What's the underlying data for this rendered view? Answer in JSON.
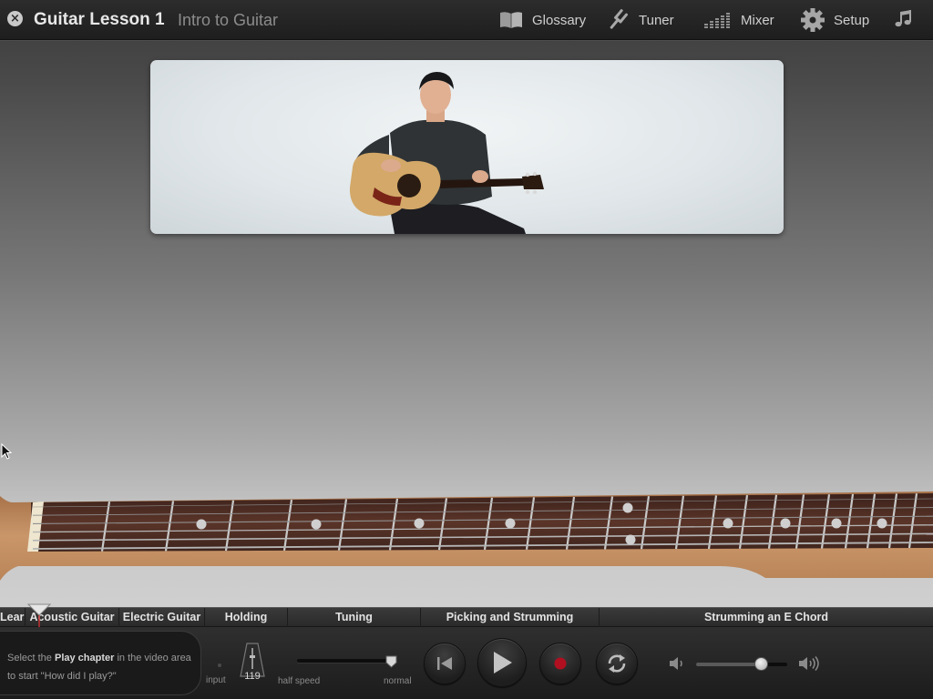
{
  "header": {
    "title": "Guitar Lesson 1",
    "subtitle": "Intro to Guitar",
    "nav": [
      {
        "label": "Glossary",
        "icon": "book-icon"
      },
      {
        "label": "Tuner",
        "icon": "tuning-fork-icon"
      },
      {
        "label": "Mixer",
        "icon": "mixer-icon"
      },
      {
        "label": "Setup",
        "icon": "gear-icon"
      },
      {
        "label": "",
        "icon": "music-note-icon"
      }
    ]
  },
  "chapters": [
    "Lear",
    "Acoustic Guitar",
    "Electric Guitar",
    "Holding",
    "Tuning",
    "Picking and Strumming",
    "Strumming an E Chord"
  ],
  "controls": {
    "hint_prefix": "Select the",
    "hint_bold": "Play chapter",
    "hint_suffix": "in the video area to start \"How did I play?\"",
    "input_label": "input",
    "tempo": "119",
    "speed_min_label": "half speed",
    "speed_max_label": "normal",
    "speed_value": 1.0,
    "volume_value": 0.72
  },
  "colors": {
    "record_red": "#b01020",
    "fretboard": "#4a2a22",
    "neck_wood": "#c79a6c"
  }
}
